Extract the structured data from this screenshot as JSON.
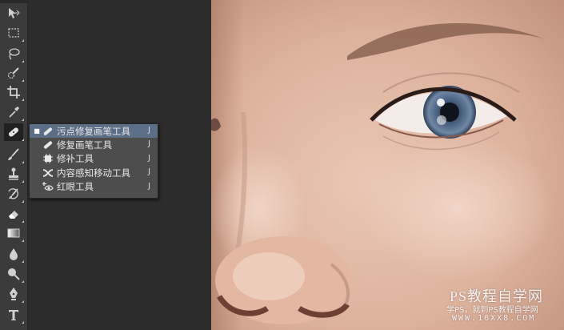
{
  "toolbar": {
    "tools": [
      {
        "icon": "move-icon"
      },
      {
        "icon": "marquee-icon"
      },
      {
        "icon": "lasso-icon"
      },
      {
        "icon": "quick-selection-icon"
      },
      {
        "icon": "crop-icon"
      },
      {
        "icon": "eyedropper-icon"
      },
      {
        "icon": "healing-brush-icon",
        "active": true
      },
      {
        "icon": "brush-icon"
      },
      {
        "icon": "clone-stamp-icon"
      },
      {
        "icon": "history-brush-icon"
      },
      {
        "icon": "eraser-icon"
      },
      {
        "icon": "gradient-icon"
      },
      {
        "icon": "blur-icon"
      },
      {
        "icon": "dodge-icon"
      },
      {
        "icon": "pen-icon"
      },
      {
        "icon": "type-icon"
      }
    ]
  },
  "flyout": {
    "items": [
      {
        "label": "污点修复画笔工具",
        "shortcut": "J",
        "icon": "spot-healing-brush-icon",
        "selected": true
      },
      {
        "label": "修复画笔工具",
        "shortcut": "J",
        "icon": "healing-brush-icon",
        "selected": false
      },
      {
        "label": "修补工具",
        "shortcut": "J",
        "icon": "patch-icon",
        "selected": false
      },
      {
        "label": "内容感知移动工具",
        "shortcut": "J",
        "icon": "content-aware-move-icon",
        "selected": false
      },
      {
        "label": "红眼工具",
        "shortcut": "J",
        "icon": "red-eye-icon",
        "selected": false
      }
    ]
  },
  "watermark": {
    "title": "PS教程自学网",
    "subtitle": "学PS，就到PS教程自学网",
    "url": "WWW.16XX8.COM"
  },
  "colors": {
    "toolbar_bg": "#3b3b3b",
    "canvas_bg": "#2c2c2c",
    "menu_bg": "#4d4d4d",
    "menu_selected": "#5b6f86"
  }
}
